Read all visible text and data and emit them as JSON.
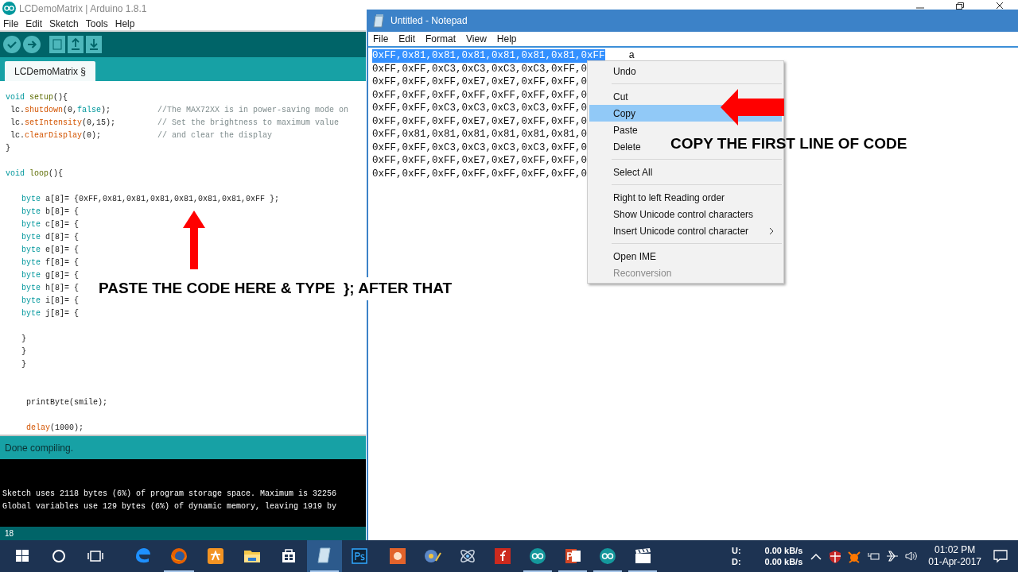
{
  "arduino": {
    "title": "LCDemoMatrix | Arduino 1.8.1",
    "menu": [
      "File",
      "Edit",
      "Sketch",
      "Tools",
      "Help"
    ],
    "toolbar": [
      {
        "kind": "verify"
      },
      {
        "kind": "upload"
      },
      {
        "kind": "new"
      },
      {
        "kind": "open"
      },
      {
        "kind": "save"
      }
    ],
    "tab": "LCDemoMatrix §",
    "code": [
      {
        "kind": "top",
        "tokens": [
          {
            "text": "void",
            "kind": "type"
          },
          {
            "text": " setup",
            "kind": "struct"
          },
          {
            "text": "(){",
            "kind": "plain"
          }
        ]
      },
      {
        "kind": "body",
        "tokens": [
          {
            "text": "lc.",
            "kind": "plain"
          },
          {
            "text": "shutdown",
            "kind": "fn"
          },
          {
            "text": "(0,",
            "kind": "plain"
          },
          {
            "text": "false",
            "kind": "type"
          },
          {
            "text": ");",
            "kind": "plain"
          }
        ],
        "comment": "//The MAX72XX is in power-saving mode on"
      },
      {
        "kind": "body",
        "tokens": [
          {
            "text": "lc.",
            "kind": "plain"
          },
          {
            "text": "setIntensity",
            "kind": "fn"
          },
          {
            "text": "(0,15);",
            "kind": "plain"
          }
        ],
        "comment": "// Set the brightness to maximum value"
      },
      {
        "kind": "body",
        "tokens": [
          {
            "text": "lc.",
            "kind": "plain"
          },
          {
            "text": "clearDisplay",
            "kind": "fn"
          },
          {
            "text": "(0);",
            "kind": "plain"
          }
        ],
        "comment": "// and clear the display"
      },
      {
        "kind": "top",
        "tokens": [
          {
            "text": "}",
            "kind": "plain"
          }
        ]
      },
      {
        "kind": "blank"
      },
      {
        "kind": "top",
        "tokens": [
          {
            "text": "void",
            "kind": "type"
          },
          {
            "text": " loop",
            "kind": "struct"
          },
          {
            "text": "(){",
            "kind": "plain"
          }
        ]
      },
      {
        "kind": "blank"
      },
      {
        "kind": "inner",
        "tokens": [
          {
            "text": "byte",
            "kind": "type"
          },
          {
            "text": " a[8]= {0xFF,0x81,0x81,0x81,0x81,0x81,0x81,0xFF };",
            "kind": "plain"
          }
        ]
      },
      {
        "kind": "inner",
        "tokens": [
          {
            "text": "byte",
            "kind": "type"
          },
          {
            "text": " b[8]= {",
            "kind": "plain"
          }
        ]
      },
      {
        "kind": "inner",
        "tokens": [
          {
            "text": "byte",
            "kind": "type"
          },
          {
            "text": " c[8]= {",
            "kind": "plain"
          }
        ]
      },
      {
        "kind": "inner",
        "tokens": [
          {
            "text": "byte",
            "kind": "type"
          },
          {
            "text": " d[8]= {",
            "kind": "plain"
          }
        ]
      },
      {
        "kind": "inner",
        "tokens": [
          {
            "text": "byte",
            "kind": "type"
          },
          {
            "text": " e[8]= {",
            "kind": "plain"
          }
        ]
      },
      {
        "kind": "inner",
        "tokens": [
          {
            "text": "byte",
            "kind": "type"
          },
          {
            "text": " f[8]= {",
            "kind": "plain"
          }
        ]
      },
      {
        "kind": "inner",
        "tokens": [
          {
            "text": "byte",
            "kind": "type"
          },
          {
            "text": " g[8]= {",
            "kind": "plain"
          }
        ]
      },
      {
        "kind": "inner",
        "tokens": [
          {
            "text": "byte",
            "kind": "type"
          },
          {
            "text": " h[8]= {",
            "kind": "plain"
          }
        ]
      },
      {
        "kind": "inner",
        "tokens": [
          {
            "text": "byte",
            "kind": "type"
          },
          {
            "text": " i[8]= {",
            "kind": "plain"
          }
        ]
      },
      {
        "kind": "inner",
        "tokens": [
          {
            "text": "byte",
            "kind": "type"
          },
          {
            "text": " j[8]= {",
            "kind": "plain"
          }
        ]
      },
      {
        "kind": "blank"
      },
      {
        "kind": "inner",
        "tokens": [
          {
            "text": "}",
            "kind": "plain"
          }
        ]
      },
      {
        "kind": "inner",
        "tokens": [
          {
            "text": "}",
            "kind": "plain"
          }
        ]
      },
      {
        "kind": "inner",
        "tokens": [
          {
            "text": "}",
            "kind": "plain"
          }
        ]
      },
      {
        "kind": "blank"
      },
      {
        "kind": "blank"
      },
      {
        "kind": "deep",
        "tokens": [
          {
            "text": "printByte(smile);",
            "kind": "plain"
          }
        ]
      },
      {
        "kind": "blank"
      },
      {
        "kind": "deep",
        "tokens": [
          {
            "text": "delay",
            "kind": "fn"
          },
          {
            "text": "(1000);",
            "kind": "plain"
          }
        ]
      }
    ],
    "status": "Done compiling.",
    "console": [
      "Sketch uses 2118 bytes (6%) of program storage space. Maximum is 32256",
      "Global variables use 129 bytes (6%) of dynamic memory, leaving 1919 by"
    ],
    "line_number": "18"
  },
  "notepad": {
    "title": "Untitled - Notepad",
    "menu": [
      "File",
      "Edit",
      "Format",
      "View",
      "Help"
    ],
    "lines": [
      {
        "text": "0xFF,0x81,0x81,0x81,0x81,0x81,0x81,0xFF",
        "selected": true,
        "tail": "a"
      },
      {
        "text": "0xFF,0xFF,0xC3,0xC3,0xC3,0xC3,0xFF,0",
        "selected": false
      },
      {
        "text": "0xFF,0xFF,0xFF,0xE7,0xE7,0xFF,0xFF,0",
        "selected": false
      },
      {
        "text": "0xFF,0xFF,0xFF,0xFF,0xFF,0xFF,0xFF,0",
        "selected": false
      },
      {
        "text": "0xFF,0xFF,0xC3,0xC3,0xC3,0xC3,0xFF,0",
        "selected": false
      },
      {
        "text": "0xFF,0xFF,0xFF,0xE7,0xE7,0xFF,0xFF,0",
        "selected": false
      },
      {
        "text": "0xFF,0x81,0x81,0x81,0x81,0x81,0x81,0",
        "selected": false
      },
      {
        "text": "0xFF,0xFF,0xC3,0xC3,0xC3,0xC3,0xFF,0",
        "selected": false
      },
      {
        "text": "0xFF,0xFF,0xFF,0xE7,0xE7,0xFF,0xFF,0",
        "selected": false
      },
      {
        "text": "0xFF,0xFF,0xFF,0xFF,0xFF,0xFF,0xFF,0",
        "selected": false
      }
    ]
  },
  "context_menu": [
    {
      "kind": "item",
      "label": "Undo",
      "selected": false,
      "disabled": false
    },
    {
      "kind": "separator"
    },
    {
      "kind": "item",
      "label": "Cut",
      "selected": false,
      "disabled": false
    },
    {
      "kind": "item",
      "label": "Copy",
      "selected": true,
      "disabled": false
    },
    {
      "kind": "item",
      "label": "Paste",
      "selected": false,
      "disabled": false
    },
    {
      "kind": "item",
      "label": "Delete",
      "selected": false,
      "disabled": false
    },
    {
      "kind": "separator"
    },
    {
      "kind": "item",
      "label": "Select All",
      "selected": false,
      "disabled": false
    },
    {
      "kind": "separator"
    },
    {
      "kind": "item",
      "label": "Right to left Reading order",
      "selected": false,
      "disabled": false
    },
    {
      "kind": "item",
      "label": "Show Unicode control characters",
      "selected": false,
      "disabled": false
    },
    {
      "kind": "submenu",
      "label": "Insert Unicode control character",
      "selected": false,
      "disabled": false
    },
    {
      "kind": "separator"
    },
    {
      "kind": "item",
      "label": "Open IME",
      "selected": false,
      "disabled": false
    },
    {
      "kind": "item",
      "label": "Reconversion",
      "selected": false,
      "disabled": true
    }
  ],
  "annotations": [
    {
      "kind": "up",
      "text": "PASTE THE CODE HERE & TYPE  }; AFTER THAT"
    },
    {
      "kind": "left",
      "text": "COPY THE FIRST LINE OF CODE"
    }
  ],
  "taskbar": {
    "apps": [
      {
        "kind": "start",
        "running": false,
        "focused": false
      },
      {
        "kind": "search",
        "running": false,
        "focused": false
      },
      {
        "kind": "taskview",
        "running": false,
        "focused": false
      },
      {
        "kind": "edge",
        "running": false,
        "focused": false
      },
      {
        "kind": "firefox",
        "running": true,
        "focused": false
      },
      {
        "kind": "squirrel",
        "running": false,
        "focused": false
      },
      {
        "kind": "folder",
        "running": false,
        "focused": false
      },
      {
        "kind": "store",
        "running": false,
        "focused": false
      },
      {
        "kind": "notepad",
        "running": true,
        "focused": true
      },
      {
        "kind": "ps",
        "running": false,
        "focused": false
      },
      {
        "kind": "recorder",
        "running": false,
        "focused": false
      },
      {
        "kind": "film",
        "running": false,
        "focused": false
      },
      {
        "kind": "atom",
        "running": false,
        "focused": false
      },
      {
        "kind": "flash",
        "running": false,
        "focused": false
      },
      {
        "kind": "arduino",
        "running": true,
        "focused": false
      },
      {
        "kind": "ppt",
        "running": true,
        "focused": false
      },
      {
        "kind": "arduino",
        "running": true,
        "focused": false
      },
      {
        "kind": "clapper",
        "running": true,
        "focused": false
      }
    ],
    "net": [
      {
        "label": "U:",
        "speed": "0.00 kB/s"
      },
      {
        "label": "D:",
        "speed": "0.00 kB/s"
      }
    ],
    "time": "01:02 PM",
    "date": "01-Apr-2017"
  }
}
